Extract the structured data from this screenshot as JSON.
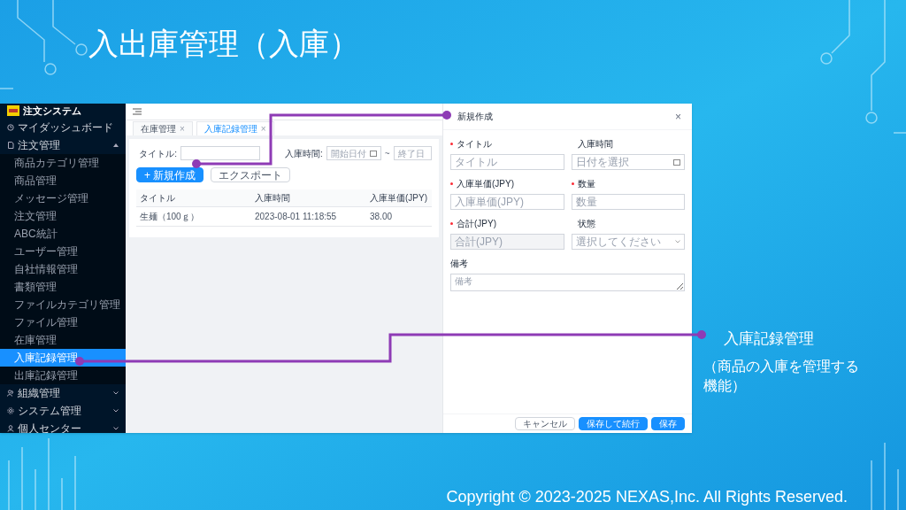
{
  "slide_title": "入出庫管理（入庫）",
  "app": {
    "title": "注文システム",
    "menu": [
      {
        "label": "マイダッシュボード",
        "has_children": false
      },
      {
        "label": "注文管理",
        "has_children": true,
        "expanded": true,
        "children": [
          {
            "label": "商品カテゴリ管理",
            "selected": false
          },
          {
            "label": "商品管理",
            "selected": false
          },
          {
            "label": "メッセージ管理",
            "selected": false
          },
          {
            "label": "注文管理",
            "selected": false
          },
          {
            "label": "ABC統計",
            "selected": false
          },
          {
            "label": "ユーザー管理",
            "selected": false
          },
          {
            "label": "自社情報管理",
            "selected": false
          },
          {
            "label": "書類管理",
            "selected": false
          },
          {
            "label": "ファイルカテゴリ管理",
            "selected": false
          },
          {
            "label": "ファイル管理",
            "selected": false
          },
          {
            "label": "在庫管理",
            "selected": false
          },
          {
            "label": "入庫記録管理",
            "selected": true
          },
          {
            "label": "出庫記録管理",
            "selected": false
          }
        ]
      },
      {
        "label": "組織管理",
        "has_children": true,
        "expanded": false
      },
      {
        "label": "システム管理",
        "has_children": true,
        "expanded": false
      },
      {
        "label": "個人センター",
        "has_children": true,
        "expanded": false
      }
    ],
    "tabs": [
      {
        "label": "在庫管理",
        "close": "×",
        "selected": false
      },
      {
        "label": "入庫記録管理",
        "close": "×",
        "selected": true
      }
    ],
    "filter": {
      "title_label": "タイトル:",
      "time_label": "入庫時間:",
      "start_placeholder": "開始日付",
      "separator": "~",
      "end_placeholder": "終了日"
    },
    "actions": [
      {
        "label": "新規作成",
        "kind": "primary",
        "icon": "+"
      },
      {
        "label": "エクスポート",
        "kind": "default"
      }
    ],
    "table": {
      "columns": [
        "タイトル",
        "入庫時間",
        "入庫単価(JPY)"
      ],
      "rows": [
        [
          "生麺（100ｇ）",
          "2023-08-01 11:18:55",
          "38.00"
        ]
      ]
    },
    "drawer": {
      "title": "新規作成",
      "close": "×",
      "fields": [
        {
          "label": "タイトル",
          "required": true,
          "placeholder": "タイトル",
          "kind": "text",
          "disabled": false
        },
        {
          "label": "入庫時間",
          "required": false,
          "placeholder": "日付を選択",
          "kind": "date",
          "disabled": false
        },
        {
          "label": "入庫単価(JPY)",
          "required": true,
          "placeholder": "入庫単価(JPY)",
          "kind": "text",
          "disabled": false
        },
        {
          "label": "数量",
          "required": true,
          "placeholder": "数量",
          "kind": "text",
          "disabled": false
        },
        {
          "label": "合計(JPY)",
          "required": true,
          "placeholder": "合計(JPY)",
          "kind": "text",
          "disabled": true
        },
        {
          "label": "状態",
          "required": false,
          "placeholder": "選択してください",
          "kind": "select",
          "disabled": false
        }
      ],
      "remark": {
        "label": "備考",
        "placeholder": "備考"
      },
      "buttons": [
        {
          "label": "キャンセル",
          "kind": "default"
        },
        {
          "label": "保存して続行",
          "kind": "primary"
        },
        {
          "label": "保存",
          "kind": "primary"
        }
      ]
    }
  },
  "callout": {
    "title": "入庫記録管理",
    "description": "（商品の入庫を管理する機能）"
  },
  "copyright": "Copyright © 2023-2025 NEXAS,Inc. All Rights Reserved."
}
